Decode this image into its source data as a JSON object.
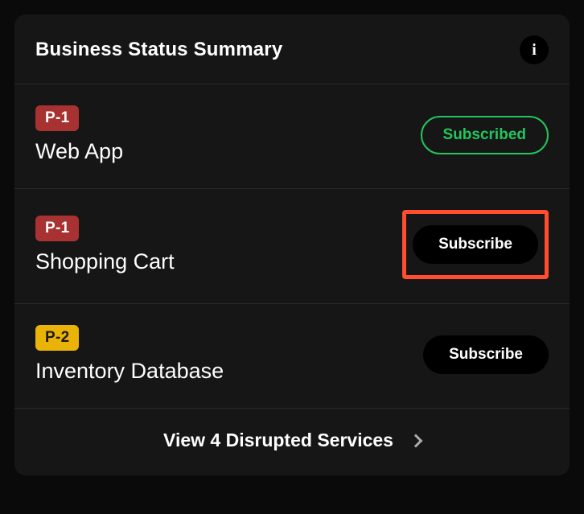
{
  "header": {
    "title": "Business Status Summary",
    "info_icon": "i"
  },
  "services": [
    {
      "priority": "P-1",
      "priority_class": "p1",
      "name": "Web App",
      "button_label": "Subscribed",
      "button_style": "subscribed",
      "highlighted": false
    },
    {
      "priority": "P-1",
      "priority_class": "p1",
      "name": "Shopping Cart",
      "button_label": "Subscribe",
      "button_style": "subscribe",
      "highlighted": true
    },
    {
      "priority": "P-2",
      "priority_class": "p2",
      "name": "Inventory Database",
      "button_label": "Subscribe",
      "button_style": "subscribe",
      "highlighted": false
    }
  ],
  "footer": {
    "label": "View 4 Disrupted Services"
  }
}
